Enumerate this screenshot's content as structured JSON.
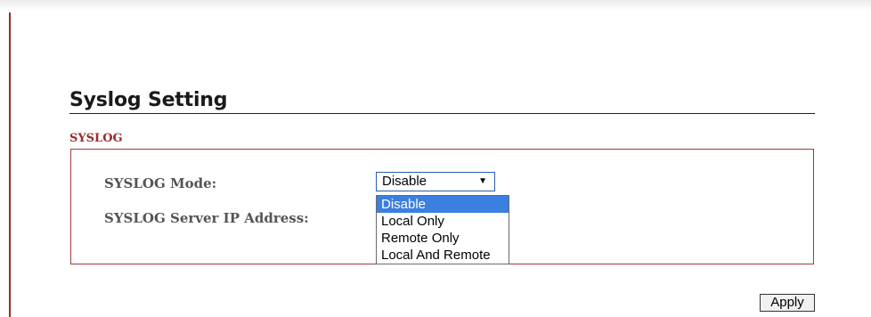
{
  "page": {
    "title": "Syslog Setting"
  },
  "section": {
    "label": "SYSLOG"
  },
  "fields": {
    "mode_label": "SYSLOG Mode:",
    "server_ip_label": "SYSLOG Server IP Address:"
  },
  "mode_select": {
    "selected_value": "Disable",
    "arrow_icon": "triangle-down",
    "options": [
      {
        "label": "Disable",
        "highlighted": true
      },
      {
        "label": "Local Only",
        "highlighted": false
      },
      {
        "label": "Remote Only",
        "highlighted": false
      },
      {
        "label": "Local And Remote",
        "highlighted": false
      }
    ]
  },
  "actions": {
    "apply_label": "Apply"
  },
  "colors": {
    "accent": "#9a2c2c",
    "highlight": "#3b7fe0"
  }
}
